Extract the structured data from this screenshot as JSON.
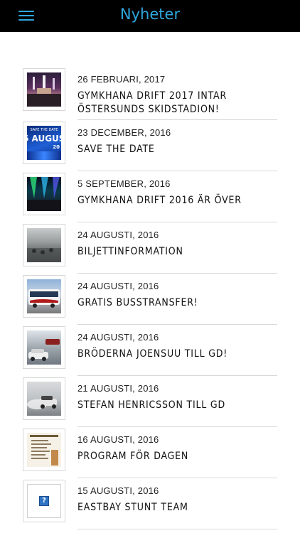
{
  "header": {
    "title": "Nyheter"
  },
  "news": [
    {
      "date": "26 FEBRUARI, 2017",
      "title": "GYMKHANA DRIFT 2017 INTAR ÖSTERSUNDS SKIDSTADION!",
      "thumb": "concert-crowd"
    },
    {
      "date": "23 DECEMBER, 2016",
      "title": "SAVE THE DATE",
      "thumb": "save-the-date",
      "thumb_text_top": "SAVE THE DATE",
      "thumb_text_main": "6 AUGUST",
      "thumb_text_sub": "20"
    },
    {
      "date": "5 SEPTEMBER, 2016",
      "title": "GYMKHANA DRIFT 2016 ÄR ÖVER",
      "thumb": "laser-show"
    },
    {
      "date": "24 AUGUSTI, 2016",
      "title": "BILJETTINFORMATION",
      "thumb": "crowd-fog"
    },
    {
      "date": "24 AUGUSTI, 2016",
      "title": "GRATIS BUSSTRANSFER!",
      "thumb": "bus"
    },
    {
      "date": "24 AUGUSTI, 2016",
      "title": "BRÖDERNA JOENSUU TILL GD!",
      "thumb": "drift-cars"
    },
    {
      "date": "21 AUGUSTI, 2016",
      "title": "STEFAN HENRICSSON TILL GD",
      "thumb": "drift-smoke"
    },
    {
      "date": "16 AUGUSTI, 2016",
      "title": "PROGRAM FÖR DAGEN",
      "thumb": "program-sheet"
    },
    {
      "date": "15 AUGUSTI, 2016",
      "title": "EASTBAY STUNT TEAM",
      "thumb": "missing-image",
      "thumb_text_main": "?"
    }
  ]
}
